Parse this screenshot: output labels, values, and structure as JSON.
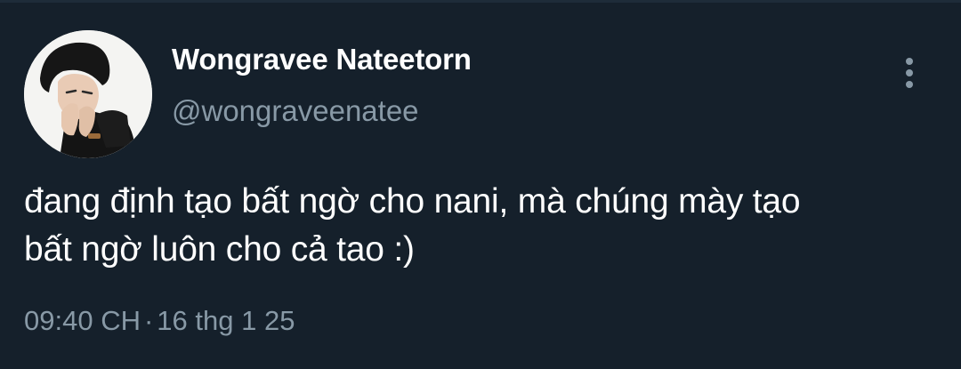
{
  "tweet": {
    "display_name": "Wongravee Nateetorn",
    "handle": "@wongraveenatee",
    "text": "đang định tạo bất ngờ cho nani, mà chúng mày tạo\nbất ngờ luôn cho cả tao :)",
    "time": "09:40 CH",
    "separator": "·",
    "date": "16 thg 1 25"
  },
  "icons": {
    "more": "more-vertical-icon"
  },
  "colors": {
    "background": "#15202b",
    "primary_text": "#ffffff",
    "secondary_text": "#8899a6"
  }
}
